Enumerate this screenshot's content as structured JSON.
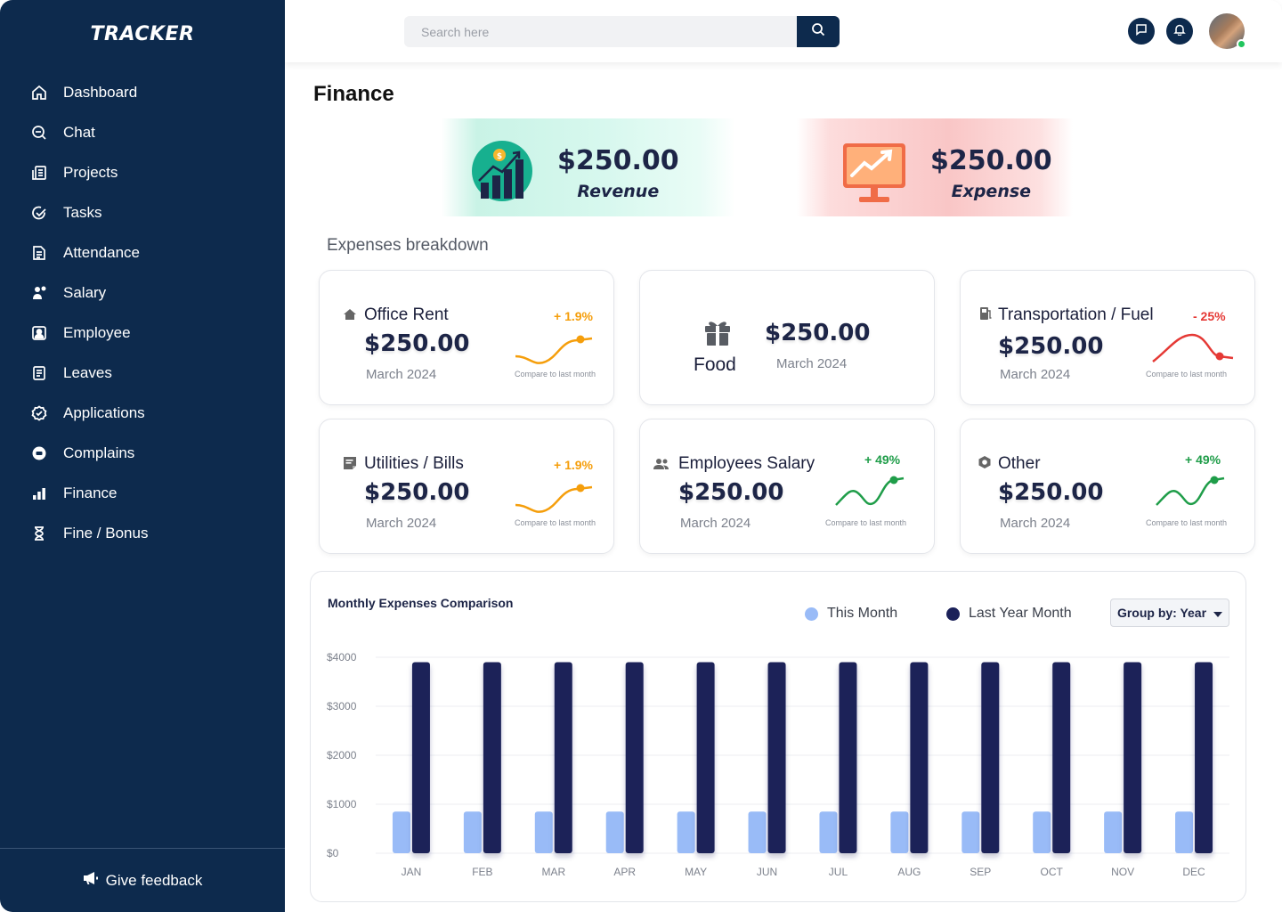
{
  "app": {
    "logo": "TRACKER"
  },
  "sidebar": {
    "items": [
      {
        "label": "Dashboard",
        "icon": "home-icon"
      },
      {
        "label": "Chat",
        "icon": "chat-icon"
      },
      {
        "label": "Projects",
        "icon": "projects-icon"
      },
      {
        "label": "Tasks",
        "icon": "tasks-icon"
      },
      {
        "label": "Attendance",
        "icon": "attendance-icon"
      },
      {
        "label": "Salary",
        "icon": "salary-icon"
      },
      {
        "label": "Employee",
        "icon": "employee-icon"
      },
      {
        "label": "Leaves",
        "icon": "leaves-icon"
      },
      {
        "label": "Applications",
        "icon": "applications-icon"
      },
      {
        "label": "Complains",
        "icon": "complains-icon"
      },
      {
        "label": "Finance",
        "icon": "finance-icon"
      },
      {
        "label": "Fine / Bonus",
        "icon": "hourglass-icon"
      }
    ],
    "feedback": "Give feedback"
  },
  "header": {
    "search_placeholder": "Search here"
  },
  "page": {
    "title": "Finance"
  },
  "summary": {
    "revenue": {
      "amount": "$250.00",
      "label": "Revenue"
    },
    "expense": {
      "amount": "$250.00",
      "label": "Expense"
    }
  },
  "breakdown": {
    "title": "Expenses breakdown",
    "cards": [
      {
        "title": "Office Rent",
        "amount": "$250.00",
        "date": "March 2024",
        "change": "+ 1.9%",
        "compare": "Compare to last month"
      },
      {
        "title": "Food",
        "amount": "$250.00",
        "date": "March 2024"
      },
      {
        "title": "Transportation / Fuel",
        "amount": "$250.00",
        "date": "March 2024",
        "change": "- 25%",
        "compare": "Compare to last month"
      },
      {
        "title": "Utilities / Bills",
        "amount": "$250.00",
        "date": "March 2024",
        "change": "+ 1.9%",
        "compare": "Compare to last month"
      },
      {
        "title": "Employees Salary",
        "amount": "$250.00",
        "date": "March 2024",
        "change": "+ 49%",
        "compare": "Compare to last month"
      },
      {
        "title": "Other",
        "amount": "$250.00",
        "date": "March 2024",
        "change": "+ 49%",
        "compare": "Compare to last month"
      }
    ]
  },
  "colors": {
    "sidebar": "#0d2a4d",
    "up_orange": "#f59e0b",
    "down_red": "#e53935",
    "up_green": "#1f9d49",
    "bar_this": "#99bbf7",
    "bar_last": "#1b2159"
  },
  "chart_panel": {
    "group_by": "Group by: Year"
  },
  "chart_data": {
    "type": "bar",
    "title": "Monthly Expenses Comparison",
    "categories": [
      "JAN",
      "FEB",
      "MAR",
      "APR",
      "MAY",
      "JUN",
      "JUL",
      "AUG",
      "SEP",
      "OCT",
      "NOV",
      "DEC"
    ],
    "series": [
      {
        "name": "This Month",
        "color": "#99bbf7",
        "values": [
          850,
          850,
          850,
          850,
          850,
          850,
          850,
          850,
          850,
          850,
          850,
          850
        ]
      },
      {
        "name": "Last Year Month",
        "color": "#1b2159",
        "values": [
          3900,
          3900,
          3900,
          3900,
          3900,
          3900,
          3900,
          3900,
          3900,
          3900,
          3900,
          3900
        ]
      }
    ],
    "y_ticks": [
      "$0",
      "$1000",
      "$2000",
      "$3000",
      "$4000"
    ],
    "ylim": [
      0,
      4000
    ],
    "grid": true,
    "legend": "top-right"
  }
}
